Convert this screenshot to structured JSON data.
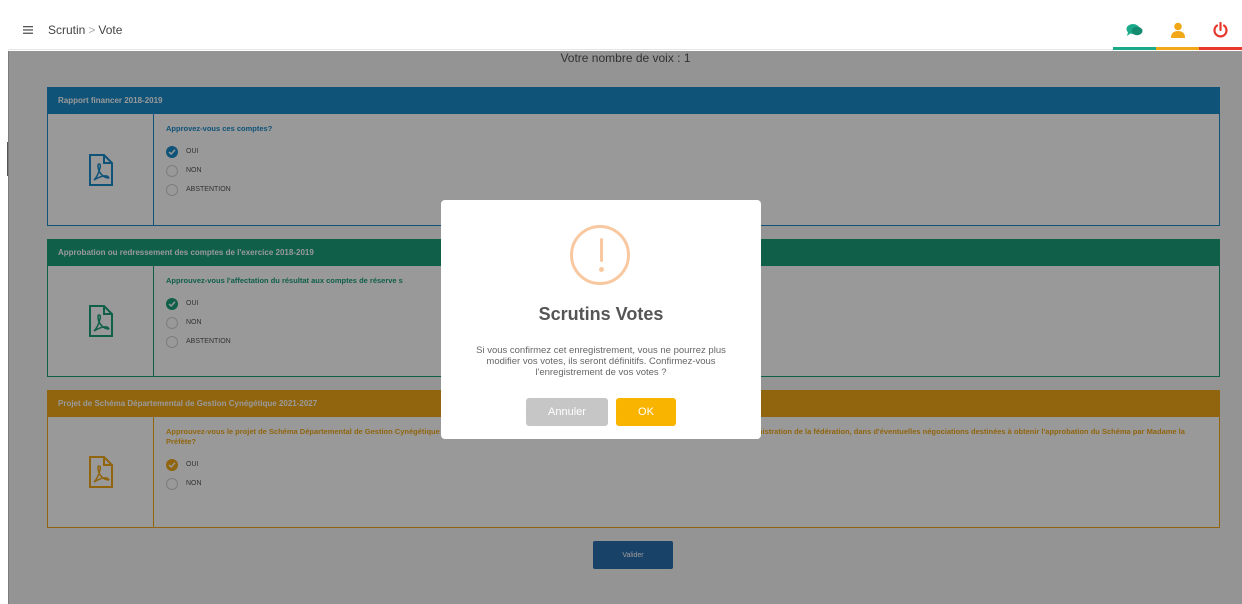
{
  "breadcrumb": {
    "root": "Scrutin",
    "current": "Vote"
  },
  "page": {
    "voices_text": "Votre nombre de voix : 1",
    "submit_label": "Valider"
  },
  "cards": [
    {
      "header": "Rapport financer 2018-2019",
      "color": "#1a8ac9",
      "question": "Approvez-vous ces comptes?",
      "options": [
        "OUI",
        "NON",
        "ABSTENTION"
      ],
      "selected": 0
    },
    {
      "header": "Approbation ou redressement des comptes de l'exercice 2018-2019",
      "color": "#1a9e7a",
      "question": "Approuvez-vous l'affectation du résultat aux comptes de réserve s",
      "options": [
        "OUI",
        "NON",
        "ABSTENTION"
      ],
      "selected": 0
    },
    {
      "header": "Projet de Schéma Départemental de Gestion Cynégétique 2021-2027",
      "color": "#f0a818",
      "question": "Approuvez-vous le projet de Schéma Départemental de Gestion Cynégétique et acceptez-vous de donner une charge de conciliation du président et au conseil d'administration de la fédération, dans d'éventuelles négociations destinées à obtenir l'approbation du Schéma par Madame la Préfète?",
      "options": [
        "OUI",
        "NON"
      ],
      "selected": 0
    }
  ],
  "modal": {
    "title": "Scrutins Votes",
    "message": "Si vous confirmez cet enregistrement, vous ne pourrez plus modifier vos votes, ils seront définitifs. Confirmez-vous l'enregistrement de vos votes ?",
    "cancel_label": "Annuler",
    "ok_label": "OK"
  },
  "top_actions": [
    {
      "icon": "chat-icon",
      "color": "#1aaa8a"
    },
    {
      "icon": "user-icon",
      "color": "#f0a818"
    },
    {
      "icon": "power-icon",
      "color": "#e8372c"
    }
  ]
}
